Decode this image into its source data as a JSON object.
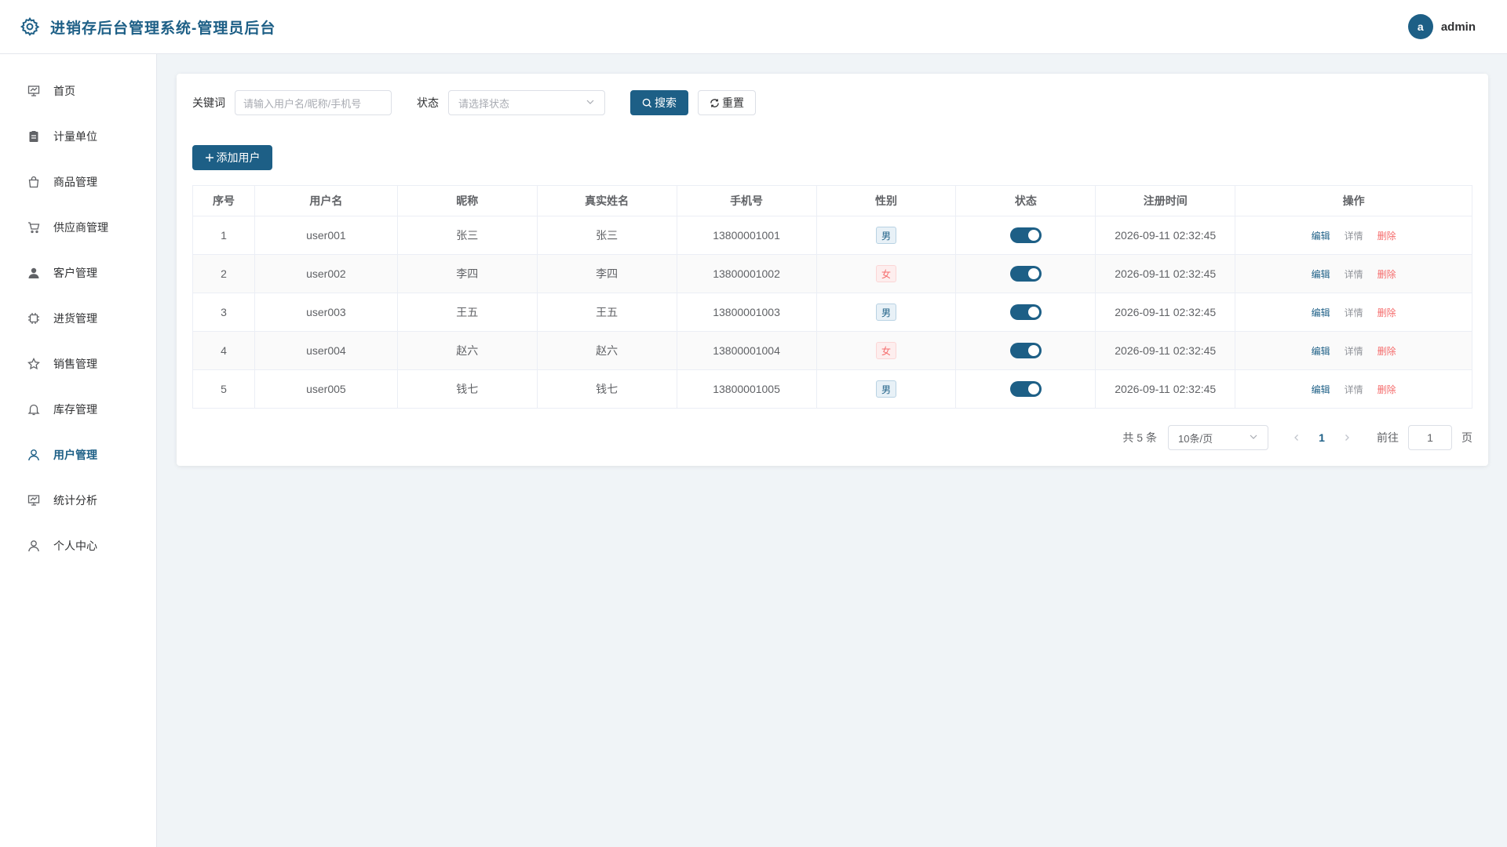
{
  "header": {
    "title": "进销存后台管理系统-管理员后台",
    "avatar_letter": "a",
    "username": "admin"
  },
  "sidebar": {
    "items": [
      {
        "label": "首页",
        "icon": "monitor-icon"
      },
      {
        "label": "计量单位",
        "icon": "clipboard-icon"
      },
      {
        "label": "商品管理",
        "icon": "shopping-bag-icon"
      },
      {
        "label": "供应商管理",
        "icon": "cart-icon"
      },
      {
        "label": "客户管理",
        "icon": "user-filled-icon"
      },
      {
        "label": "进货管理",
        "icon": "cpu-icon"
      },
      {
        "label": "销售管理",
        "icon": "star-icon"
      },
      {
        "label": "库存管理",
        "icon": "bell-icon"
      },
      {
        "label": "用户管理",
        "icon": "user-icon"
      },
      {
        "label": "统计分析",
        "icon": "presentation-icon"
      },
      {
        "label": "个人中心",
        "icon": "user-icon"
      }
    ],
    "active": "用户管理"
  },
  "filters": {
    "keyword_label": "关键词",
    "keyword_placeholder": "请输入用户名/昵称/手机号",
    "status_label": "状态",
    "status_placeholder": "请选择状态",
    "search_label": "搜索",
    "reset_label": "重置"
  },
  "toolbar": {
    "add_label": "添加用户"
  },
  "table": {
    "headers": [
      "序号",
      "用户名",
      "昵称",
      "真实姓名",
      "手机号",
      "性别",
      "状态",
      "注册时间",
      "操作"
    ],
    "rows": [
      {
        "idx": "1",
        "username": "user001",
        "nickname": "张三",
        "realname": "张三",
        "phone": "13800001001",
        "gender": "男",
        "status": true,
        "time": "2026-09-11 02:32:45"
      },
      {
        "idx": "2",
        "username": "user002",
        "nickname": "李四",
        "realname": "李四",
        "phone": "13800001002",
        "gender": "女",
        "status": true,
        "time": "2026-09-11 02:32:45"
      },
      {
        "idx": "3",
        "username": "user003",
        "nickname": "王五",
        "realname": "王五",
        "phone": "13800001003",
        "gender": "男",
        "status": true,
        "time": "2026-09-11 02:32:45"
      },
      {
        "idx": "4",
        "username": "user004",
        "nickname": "赵六",
        "realname": "赵六",
        "phone": "13800001004",
        "gender": "女",
        "status": true,
        "time": "2026-09-11 02:32:45"
      },
      {
        "idx": "5",
        "username": "user005",
        "nickname": "钱七",
        "realname": "钱七",
        "phone": "13800001005",
        "gender": "男",
        "status": true,
        "time": "2026-09-11 02:32:45"
      }
    ],
    "actions": {
      "edit": "编辑",
      "detail": "详情",
      "delete": "删除"
    }
  },
  "pagination": {
    "total_text": "共 5 条",
    "page_size": "10条/页",
    "current_page": "1",
    "goto_label": "前往",
    "goto_value": "1",
    "page_suffix": "页"
  },
  "colors": {
    "primary": "#1d5f86",
    "danger": "#f56c6c",
    "background": "#f0f4f7"
  }
}
